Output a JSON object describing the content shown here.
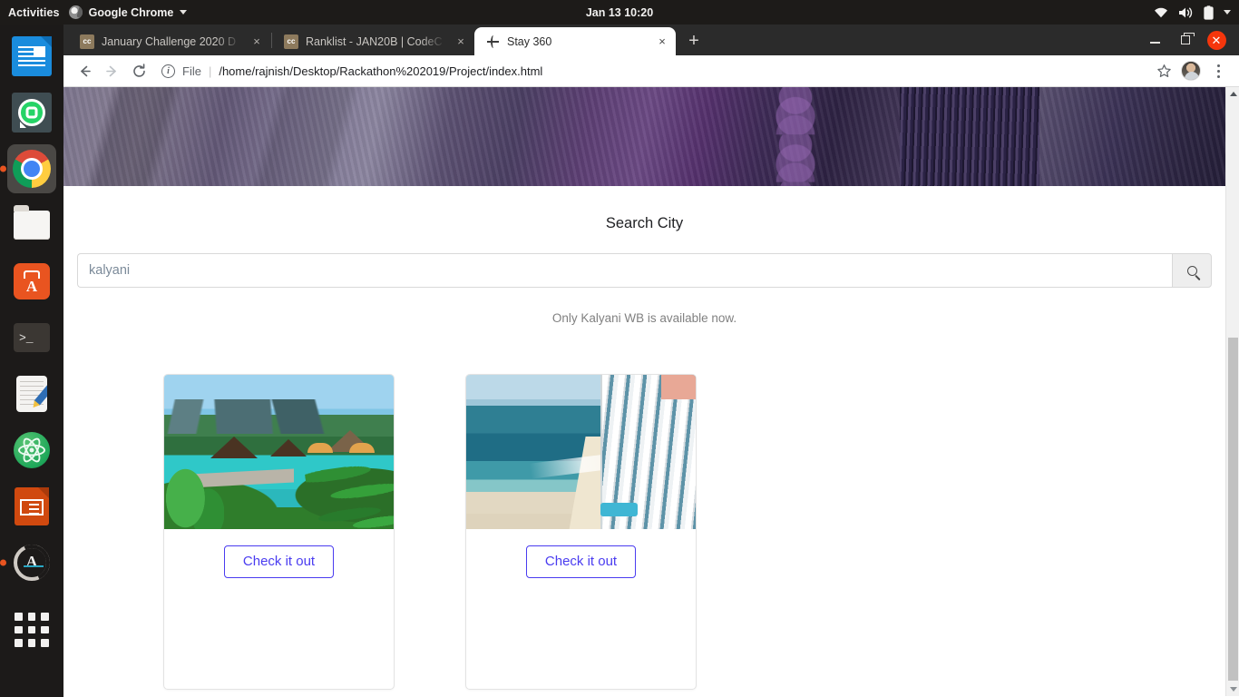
{
  "desktop": {
    "activities_label": "Activities",
    "app_menu_label": "Google Chrome",
    "clock": "Jan 13  10:20",
    "tray": {
      "wifi_icon": "wifi-icon",
      "volume_icon": "volume-icon",
      "battery_icon": "battery-icon",
      "dropdown_icon": "chevron-down-icon"
    }
  },
  "dock": {
    "items": [
      {
        "name": "libreoffice-writer",
        "label": "LibreOffice Writer",
        "running": false
      },
      {
        "name": "whatsapp",
        "label": "WhatsApp",
        "running": false
      },
      {
        "name": "google-chrome",
        "label": "Google Chrome",
        "running": true
      },
      {
        "name": "files",
        "label": "Files",
        "running": false
      },
      {
        "name": "ubuntu-software",
        "label": "Ubuntu Software",
        "running": false
      },
      {
        "name": "terminal",
        "label": "Terminal",
        "running": false
      },
      {
        "name": "text-editor",
        "label": "Text Editor",
        "running": false
      },
      {
        "name": "atom",
        "label": "Atom",
        "running": false
      },
      {
        "name": "libreoffice-impress",
        "label": "LibreOffice Impress",
        "running": false
      },
      {
        "name": "software-updater",
        "label": "Software Updater",
        "running": true
      },
      {
        "name": "show-applications",
        "label": "Show Applications",
        "running": false
      }
    ]
  },
  "browser": {
    "tabs": [
      {
        "title": "January Challenge 2020 D",
        "favicon": "codechef-icon",
        "active": false
      },
      {
        "title": "Ranklist - JAN20B | CodeC",
        "favicon": "codechef-icon",
        "active": false
      },
      {
        "title": "Stay 360",
        "favicon": "globe-icon",
        "active": true
      }
    ],
    "new_tab_label": "+",
    "close_tab_label": "×",
    "window_controls": {
      "minimize": "minimize-button",
      "maximize": "maximize-button",
      "close_label": "✕"
    },
    "toolbar": {
      "back_icon": "back-arrow-icon",
      "forward_icon": "forward-arrow-icon",
      "reload_icon": "reload-icon",
      "bookmark_icon": "star-icon",
      "profile_icon": "avatar",
      "menu_icon": "kebab-menu-icon"
    },
    "omnibox": {
      "info_glyph": "i",
      "scheme_label": "File",
      "separator": "|",
      "url": "/home/rajnish/Desktop/Rackathon%202019/Project/index.html"
    }
  },
  "page": {
    "hero_image_alt": "hotel-room-banner",
    "search_title": "Search City",
    "search_value": "kalyani",
    "search_placeholder": "Search City",
    "search_button_icon": "search-icon",
    "notice": "Only Kalyani WB is available now.",
    "cards": [
      {
        "image_alt": "tropical-resort-pool",
        "button_label": "Check it out"
      },
      {
        "image_alt": "beachfront-hotel",
        "button_label": "Check it out"
      }
    ]
  },
  "colors": {
    "accent_button": "#4a3cf0",
    "notice_text": "#808080",
    "close_button": "#f5360c",
    "dock_running_dot": "#e95420"
  }
}
